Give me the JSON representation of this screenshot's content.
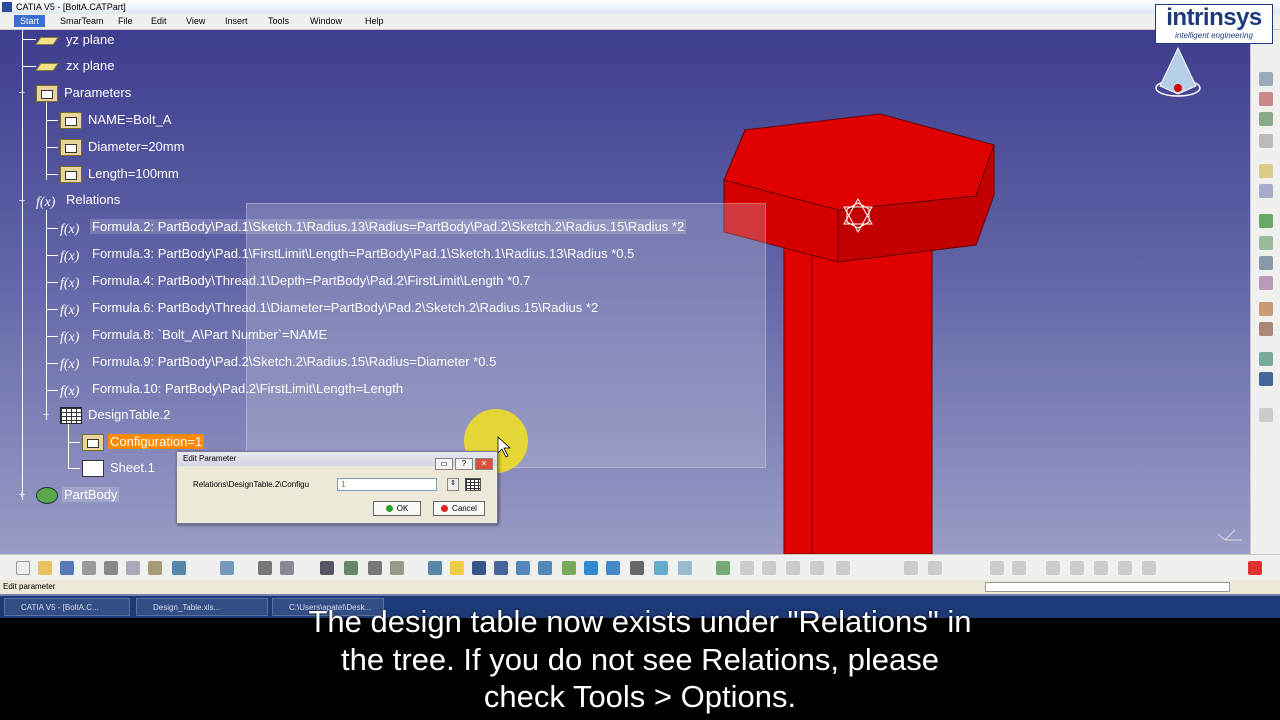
{
  "window": {
    "title": "CATIA V5 - [BoltA.CATPart]"
  },
  "menu": {
    "start": "Start",
    "items": [
      "SmarTeam",
      "File",
      "Edit",
      "View",
      "Insert",
      "Tools",
      "Window",
      "Help"
    ]
  },
  "logo": {
    "brand": "intrinsys",
    "tagline": "intelligent engineering"
  },
  "tree": {
    "planes": [
      "yz plane",
      "zx plane"
    ],
    "parameters_label": "Parameters",
    "parameters": [
      "NAME=Bolt_A",
      "Diameter=20mm",
      "Length=100mm"
    ],
    "relations_label": "Relations",
    "formulas": [
      "Formula.2: PartBody\\Pad.1\\Sketch.1\\Radius.13\\Radius=PartBody\\Pad.2\\Sketch.2\\Radius.15\\Radius *2",
      "Formula.3: PartBody\\Pad.1\\FirstLimit\\Length=PartBody\\Pad.1\\Sketch.1\\Radius.13\\Radius *0.5",
      "Formula.4: PartBody\\Thread.1\\Depth=PartBody\\Pad.2\\FirstLimit\\Length *0.7",
      "Formula.6: PartBody\\Thread.1\\Diameter=PartBody\\Pad.2\\Sketch.2\\Radius.15\\Radius *2",
      "Formula.8: `Bolt_A\\Part Number`=NAME",
      "Formula.9: PartBody\\Pad.2\\Sketch.2\\Radius.15\\Radius=Diameter *0.5",
      "Formula.10: PartBody\\Pad.2\\FirstLimit\\Length=Length"
    ],
    "design_table": "DesignTable.2",
    "configuration": "Configuration=1",
    "sheet": "Sheet.1",
    "partbody": "PartBody"
  },
  "dialog": {
    "title": "Edit Parameter",
    "param_label": "Relations\\DesignTable.2\\Configu",
    "value": "1",
    "ok_label": "OK",
    "cancel_label": "Cancel"
  },
  "status": {
    "text": "Edit parameter"
  },
  "taskbar": {
    "items": [
      "CATIA V5 - [BoltA.C...",
      "Design_Table.xls...",
      "C:\\Users\\apatel\\Desk..."
    ]
  },
  "subtitle": {
    "line1": "The design table now exists under \"Relations\" in",
    "line2": "the tree. If you do not see Relations, please",
    "line3": "check Tools > Options."
  },
  "colors": {
    "accent": "#ff8a00",
    "part": "#e00000",
    "brand": "#1d3b7c"
  }
}
